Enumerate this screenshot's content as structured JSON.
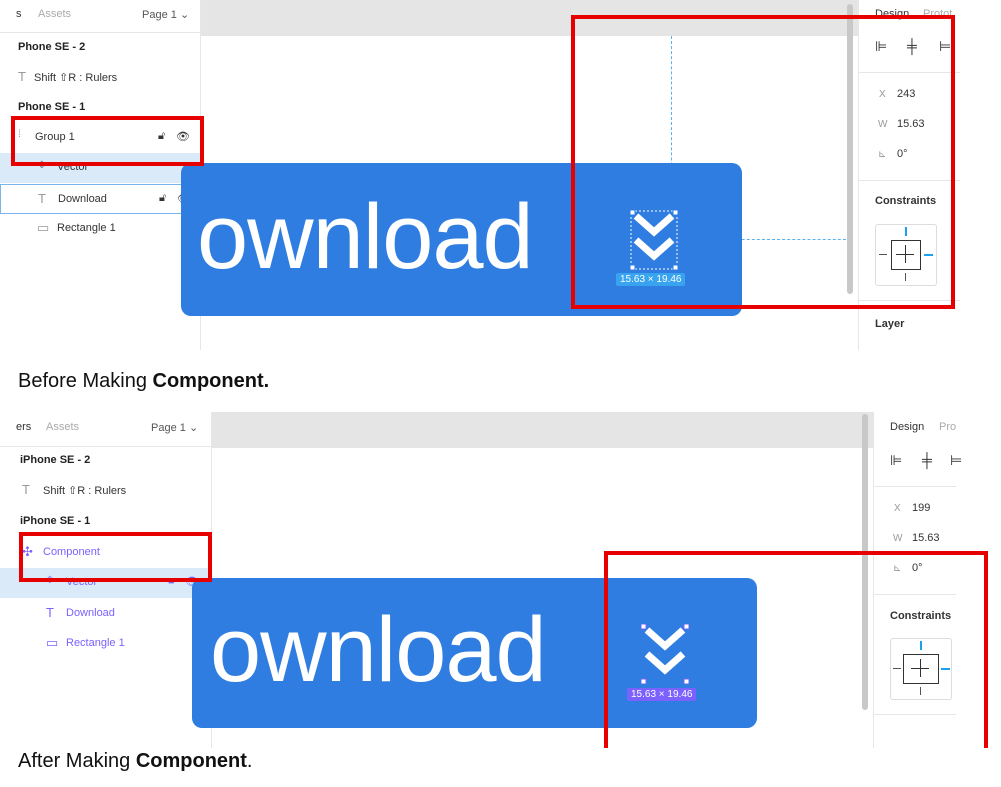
{
  "before": {
    "tabs": {
      "layers": "s",
      "assets": "Assets",
      "page": "Page 1"
    },
    "layers": [
      {
        "label": "Phone SE - 2",
        "bold": true
      },
      {
        "label": "Shift ⇧R : Rulers",
        "icon": "T"
      },
      {
        "label": "Phone SE - 1",
        "bold": true
      },
      {
        "label": "Group 1"
      },
      {
        "label": "Vector"
      },
      {
        "label": "Download",
        "icon": "T"
      },
      {
        "label": "Rectangle 1"
      }
    ],
    "button_text": "ownload",
    "dims": "15.63 × 19.46",
    "design": {
      "tab": "Design",
      "tab2": "Protot",
      "x_label": "X",
      "x_val": "243",
      "w_label": "W",
      "w_val": "15.63",
      "angle_label": "⊾",
      "angle_val": "0°",
      "constraints": "Constraints",
      "layer": "Layer"
    }
  },
  "after": {
    "tabs": {
      "layers": "ers",
      "assets": "Assets",
      "page": "Page 1"
    },
    "layers": [
      {
        "label": "iPhone SE - 2",
        "bold": true
      },
      {
        "label": "Shift ⇧R : Rulers",
        "icon": "T"
      },
      {
        "label": "iPhone SE - 1",
        "bold": true
      },
      {
        "label": "Component"
      },
      {
        "label": "Vector"
      },
      {
        "label": "Download",
        "icon": "T"
      },
      {
        "label": "Rectangle 1"
      }
    ],
    "button_text": "ownload",
    "dims": "15.63 × 19.46",
    "design": {
      "tab": "Design",
      "tab2": "Pro",
      "x_label": "X",
      "x_val": "199",
      "w_label": "W",
      "w_val": "15.63",
      "angle_label": "⊾",
      "angle_val": "0°",
      "constraints": "Constraints"
    }
  },
  "captions": {
    "before_prefix": "Before Making ",
    "before_bold": "Component.",
    "after_prefix": "After Making ",
    "after_bold": "Component",
    "after_suffix": "."
  },
  "colors": {
    "accent": "#2f7de1",
    "component": "#7b61ff",
    "highlight": "#e60000"
  }
}
